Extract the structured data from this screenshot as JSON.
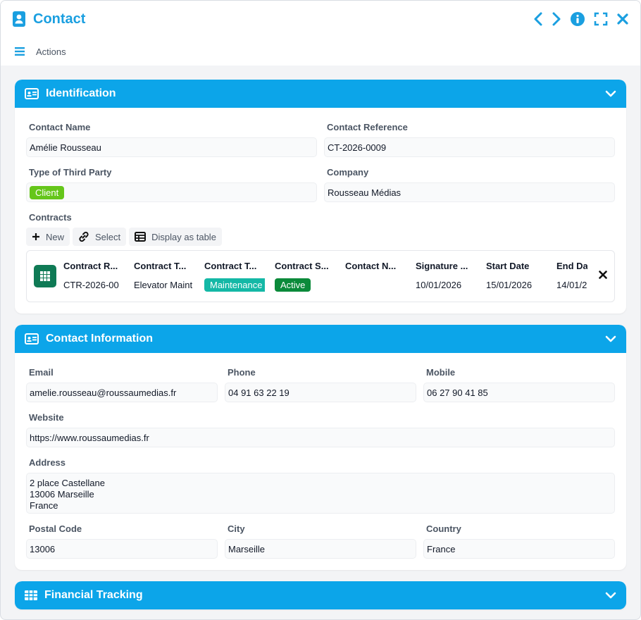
{
  "window": {
    "title": "Contact"
  },
  "actions": {
    "label": "Actions"
  },
  "identification": {
    "title": "Identification",
    "contact_name_label": "Contact Name",
    "contact_name": "Amélie Rousseau",
    "contact_ref_label": "Contact Reference",
    "contact_ref": "CT-2026-0009",
    "third_party_label": "Type of Third Party",
    "third_party": "Client",
    "company_label": "Company",
    "company": "Rousseau Médias",
    "contracts_label": "Contracts",
    "toolbar": {
      "new": "New",
      "select": "Select",
      "table": "Display as table"
    },
    "contracts": {
      "headers": [
        "Contract R...",
        "Contract T...",
        "Contract T...",
        "Contract S...",
        "Contact N...",
        "Signature ...",
        "Start Date",
        "End Da"
      ],
      "row": [
        "CTR-2026-00",
        "Elevator Maint",
        "Maintenance",
        "Active",
        "",
        "10/01/2026",
        "15/01/2026",
        "14/01/2"
      ]
    }
  },
  "contact_info": {
    "title": "Contact Information",
    "email_label": "Email",
    "email": "amelie.rousseau@roussaumedias.fr",
    "phone_label": "Phone",
    "phone": "04 91 63 22 19",
    "mobile_label": "Mobile",
    "mobile": "06 27 90 41 85",
    "website_label": "Website",
    "website": "https://www.roussaumedias.fr",
    "address_label": "Address",
    "address_lines": [
      "2 place Castellane",
      "13006 Marseille",
      "France"
    ],
    "postal_label": "Postal Code",
    "postal": "13006",
    "city_label": "City",
    "city": "Marseille",
    "country_label": "Country",
    "country": "France"
  },
  "financial": {
    "title": "Financial Tracking"
  },
  "colors": {
    "accent": "#0ca5e9",
    "title": "#1a9fe0",
    "badge_client": "#65c61a",
    "badge_maintenance": "#14b8a6",
    "badge_active": "#0b8a3a"
  }
}
